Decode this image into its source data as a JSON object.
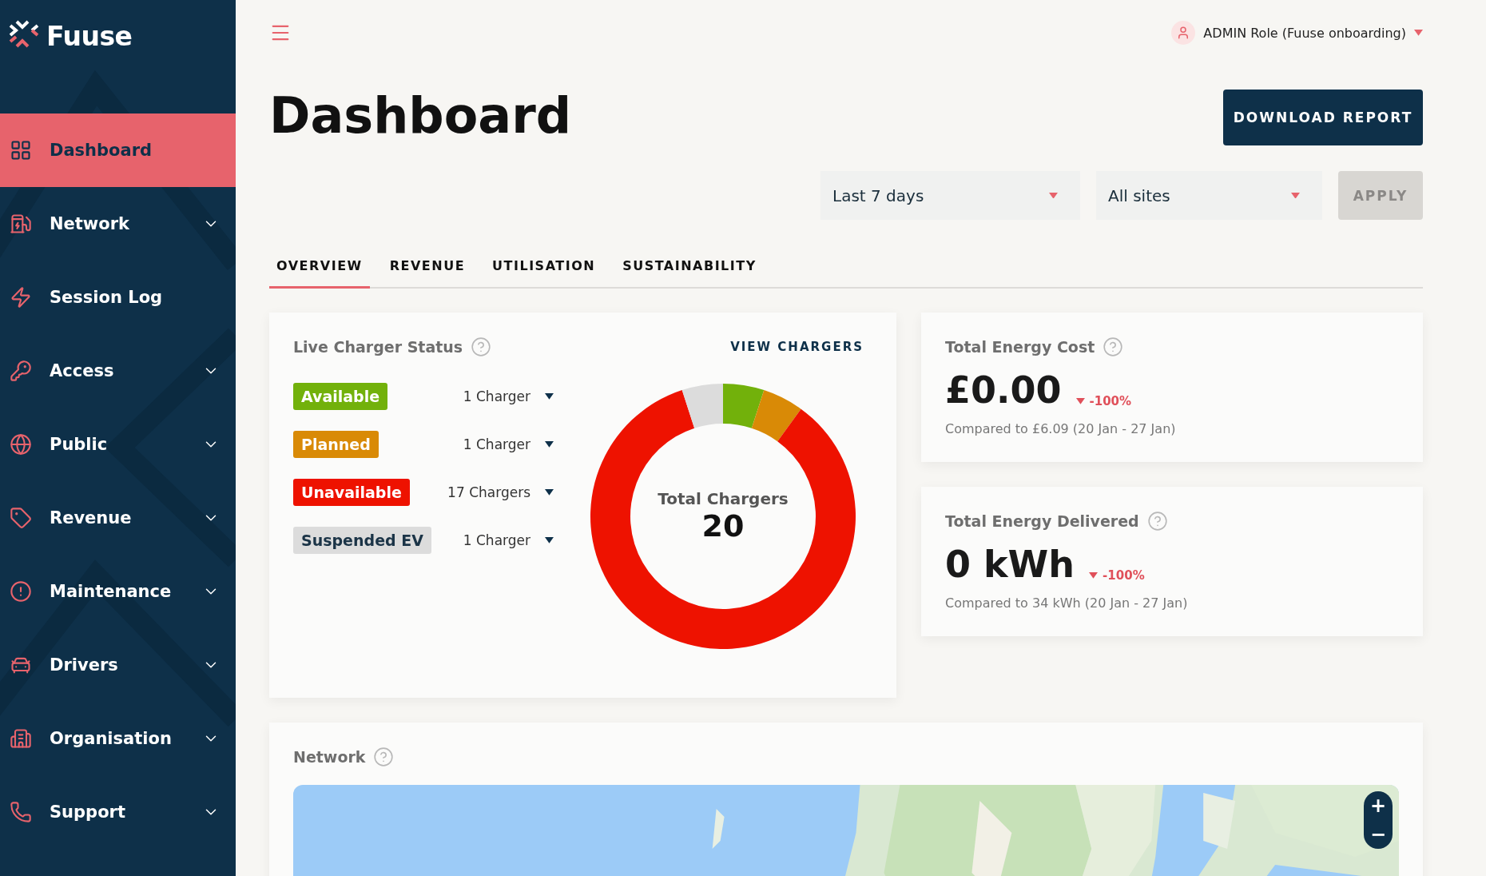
{
  "brand": {
    "name": "Fuuse"
  },
  "sidebar": {
    "items": [
      {
        "label": "Dashboard",
        "selected": true,
        "expandable": false
      },
      {
        "label": "Network",
        "selected": false,
        "expandable": true
      },
      {
        "label": "Session Log",
        "selected": false,
        "expandable": false
      },
      {
        "label": "Access",
        "selected": false,
        "expandable": true
      },
      {
        "label": "Public",
        "selected": false,
        "expandable": true
      },
      {
        "label": "Revenue",
        "selected": false,
        "expandable": true
      },
      {
        "label": "Maintenance",
        "selected": false,
        "expandable": true
      },
      {
        "label": "Drivers",
        "selected": false,
        "expandable": true
      },
      {
        "label": "Organisation",
        "selected": false,
        "expandable": true
      },
      {
        "label": "Support",
        "selected": false,
        "expandable": true
      }
    ]
  },
  "user": {
    "label": "ADMIN Role (Fuuse onboarding)"
  },
  "page": {
    "title": "Dashboard",
    "download_button": "DOWNLOAD REPORT"
  },
  "filters": {
    "period": "Last 7 days",
    "site": "All sites",
    "apply": "APPLY",
    "apply_disabled": true
  },
  "tabs": [
    {
      "label": "OVERVIEW",
      "selected": true
    },
    {
      "label": "REVENUE",
      "selected": false
    },
    {
      "label": "UTILISATION",
      "selected": false
    },
    {
      "label": "SUSTAINABILITY",
      "selected": false
    }
  ],
  "charger_status": {
    "title": "Live Charger Status",
    "link": "VIEW CHARGERS",
    "statuses": [
      {
        "label": "Available",
        "count": "1 Charger",
        "color": "#72b10b"
      },
      {
        "label": "Planned",
        "count": "1 Charger",
        "color": "#d98a06"
      },
      {
        "label": "Unavailable",
        "count": "17 Chargers",
        "color": "#ee1200"
      },
      {
        "label": "Suspended EV",
        "count": "1 Charger",
        "color": "#dcdcdc"
      }
    ],
    "total_label": "Total Chargers",
    "total": "20",
    "chart_data": {
      "type": "donut",
      "values": [
        5,
        5,
        85,
        5
      ]
    }
  },
  "metrics": [
    {
      "title": "Total Energy Cost",
      "value": "£0.00",
      "change": "-100%",
      "comparison": "Compared to £6.09 (20 Jan - 27 Jan)"
    },
    {
      "title": "Total Energy Delivered",
      "value": "0 kWh",
      "change": "-100%",
      "comparison": "Compared to 34 kWh (20 Jan - 27 Jan)"
    }
  ],
  "network": {
    "title": "Network",
    "zoom_in": "+",
    "zoom_out": "−"
  }
}
